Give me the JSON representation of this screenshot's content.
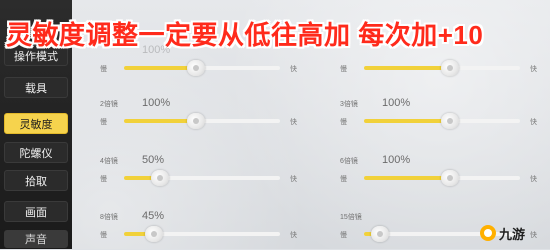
{
  "banner": {
    "text": "灵敏度调整一定要从低往高加 每次加+10",
    "color": "#ff2a1b"
  },
  "sidebar": {
    "items": [
      {
        "label": "操作模式",
        "state": "normal"
      },
      {
        "label": "载具",
        "state": "normal"
      },
      {
        "label": "灵敏度",
        "state": "active"
      },
      {
        "label": "陀螺仪",
        "state": "normal"
      },
      {
        "label": "拾取",
        "state": "normal"
      },
      {
        "label": "画面",
        "state": "normal"
      },
      {
        "label": "声音",
        "state": "dim"
      }
    ],
    "active_color": "#f6d34d"
  },
  "settings": [
    {
      "title": "",
      "value": "100%",
      "slow": "慢",
      "fast": "快",
      "level": 0.5
    },
    {
      "title": "",
      "value": "",
      "slow": "慢",
      "fast": "快",
      "level": 0.5
    },
    {
      "title": "2倍镜",
      "value": "100%",
      "slow": "慢",
      "fast": "快",
      "level": 0.5
    },
    {
      "title": "3倍镜",
      "value": "100%",
      "slow": "慢",
      "fast": "快",
      "level": 0.5
    },
    {
      "title": "4倍镜",
      "value": "50%",
      "slow": "慢",
      "fast": "快",
      "level": 0.25
    },
    {
      "title": "6倍镜",
      "value": "100%",
      "slow": "慢",
      "fast": "快",
      "level": 0.5
    },
    {
      "title": "8倍镜",
      "value": "45%",
      "slow": "慢",
      "fast": "快",
      "level": 0.2
    },
    {
      "title": "15倍镜",
      "value": "",
      "slow": "慢",
      "fast": "快",
      "level": 0.1
    }
  ],
  "logo": {
    "text": "九游",
    "icon": "jiuyou-logo-icon"
  }
}
